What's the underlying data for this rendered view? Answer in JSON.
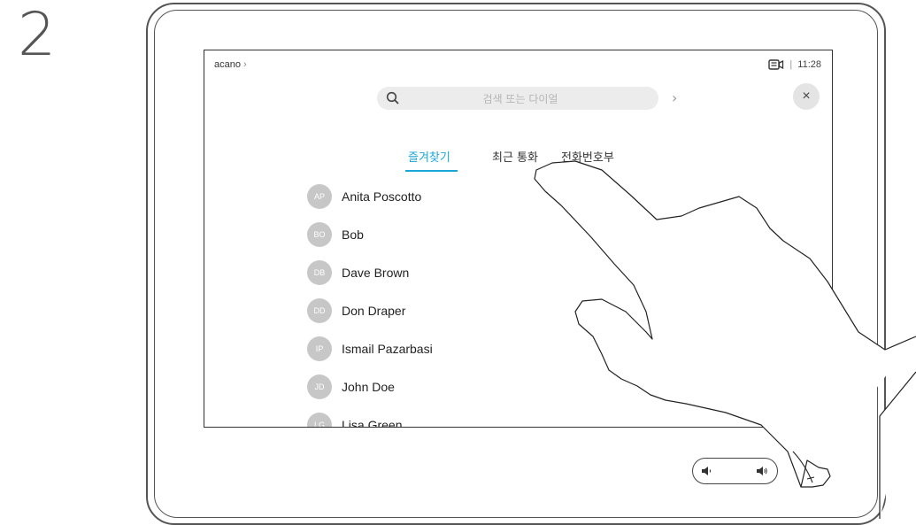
{
  "step": "2",
  "header": {
    "brand": "acano",
    "brand_chevron": "›",
    "status_icon": "camera-icon",
    "status_sep": "|",
    "time": "11:28"
  },
  "search": {
    "placeholder": "검색 또는 다이얼",
    "icon": "search-icon"
  },
  "nav": {
    "forward_chevron": "›",
    "close_label": "×"
  },
  "tabs": [
    {
      "label": "즐겨찾기",
      "active": true
    },
    {
      "label": "최근 통화",
      "active": false
    },
    {
      "label": "전화번호부",
      "active": false
    }
  ],
  "contacts": [
    {
      "initials": "AP",
      "name": "Anita Poscotto"
    },
    {
      "initials": "BO",
      "name": "Bob"
    },
    {
      "initials": "DB",
      "name": "Dave Brown"
    },
    {
      "initials": "DD",
      "name": "Don Draper"
    },
    {
      "initials": "IP",
      "name": "Ismail Pazarbasi"
    },
    {
      "initials": "JD",
      "name": "John Doe"
    },
    {
      "initials": "LG",
      "name": "Lisa Green"
    }
  ],
  "volume": {
    "down_icon": "volume-down-icon",
    "up_icon": "volume-up-icon"
  },
  "colors": {
    "accent": "#19a7d7",
    "avatar": "#c7c7c7",
    "search_bg": "#ececec"
  }
}
